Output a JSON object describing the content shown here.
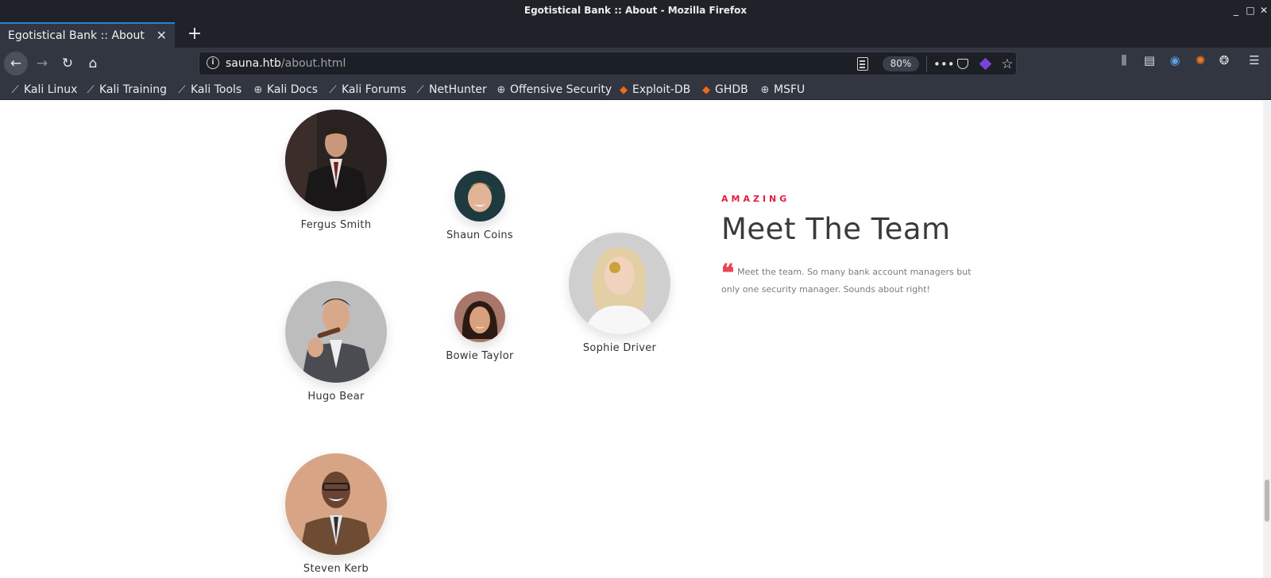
{
  "window": {
    "title": "Egotistical Bank :: About - Mozilla Firefox",
    "controls": [
      "minimize",
      "maximize",
      "close"
    ]
  },
  "tabs": [
    {
      "label": "Egotistical Bank :: About",
      "active": true
    }
  ],
  "navbar": {
    "url_host": "sauna.htb",
    "url_path": "/about.html",
    "zoom": "80%"
  },
  "bookmarks": [
    {
      "label": "Kali Linux",
      "icon": "kali-icon"
    },
    {
      "label": "Kali Training",
      "icon": "kali-icon"
    },
    {
      "label": "Kali Tools",
      "icon": "kali-icon"
    },
    {
      "label": "Kali Docs",
      "icon": "globe-icon"
    },
    {
      "label": "Kali Forums",
      "icon": "kali-icon"
    },
    {
      "label": "NetHunter",
      "icon": "kali-icon"
    },
    {
      "label": "Offensive Security",
      "icon": "globe-icon"
    },
    {
      "label": "Exploit-DB",
      "icon": "exploit-icon"
    },
    {
      "label": "GHDB",
      "icon": "exploit-icon"
    },
    {
      "label": "MSFU",
      "icon": "globe-icon"
    }
  ],
  "team": {
    "eyebrow": "AMAZING",
    "heading": "Meet The Team",
    "quote": "Meet the team. So many bank account managers but only one security manager. Sounds about right!",
    "members": [
      {
        "name": "Fergus Smith"
      },
      {
        "name": "Shaun Coins"
      },
      {
        "name": "Sophie Driver"
      },
      {
        "name": "Hugo Bear"
      },
      {
        "name": "Bowie Taylor"
      },
      {
        "name": "Steven Kerb"
      }
    ]
  },
  "colors": {
    "accent": "#e41e3f",
    "chrome_dark": "#1f2229",
    "chrome": "#323640",
    "tab_highlight": "#2a7fd4"
  }
}
